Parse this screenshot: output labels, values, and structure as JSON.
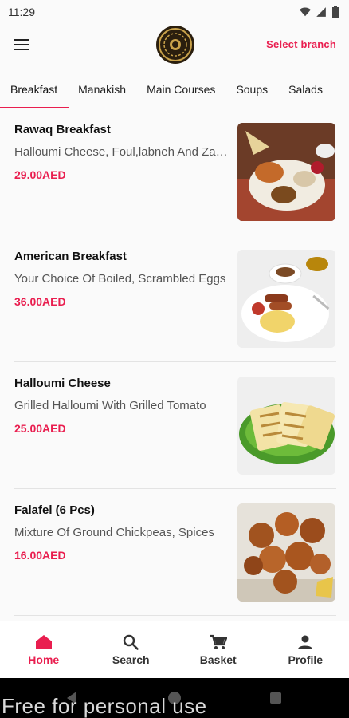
{
  "status": {
    "time": "11:29"
  },
  "header": {
    "select_branch": "Select branch"
  },
  "tabs": [
    {
      "label": "Breakfast"
    },
    {
      "label": "Manakish"
    },
    {
      "label": "Main Courses"
    },
    {
      "label": "Soups"
    },
    {
      "label": "Salads"
    }
  ],
  "items": [
    {
      "title": "Rawaq Breakfast",
      "desc": "Halloumi Cheese, Foul,labneh And Zaatar",
      "price": "29.00AED"
    },
    {
      "title": "American Breakfast",
      "desc": "Your Choice Of Boiled, Scrambled Eggs",
      "price": "36.00AED"
    },
    {
      "title": "Halloumi Cheese",
      "desc": "Grilled Halloumi With Grilled Tomato",
      "price": "25.00AED"
    },
    {
      "title": "Falafel (6 Pcs)",
      "desc": "Mixture Of Ground Chickpeas, Spices",
      "price": "16.00AED"
    }
  ],
  "nav": [
    {
      "label": "Home"
    },
    {
      "label": "Search"
    },
    {
      "label": "Basket"
    },
    {
      "label": "Profile"
    }
  ],
  "watermark": "Free for personal use",
  "colors": {
    "accent": "#e91e4f"
  }
}
